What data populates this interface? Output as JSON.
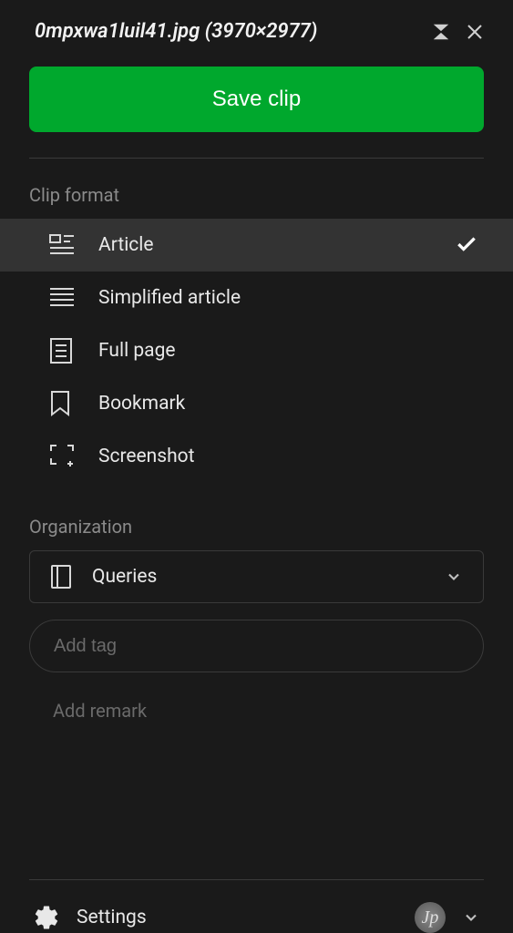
{
  "header": {
    "title": "0mpxwa1luil41.jpg (3970×2977)"
  },
  "actions": {
    "save_label": "Save clip"
  },
  "clip_format": {
    "label": "Clip format",
    "items": [
      {
        "id": "article",
        "label": "Article",
        "selected": true
      },
      {
        "id": "simplified",
        "label": "Simplified article",
        "selected": false
      },
      {
        "id": "fullpage",
        "label": "Full page",
        "selected": false
      },
      {
        "id": "bookmark",
        "label": "Bookmark",
        "selected": false
      },
      {
        "id": "screenshot",
        "label": "Screenshot",
        "selected": false
      }
    ]
  },
  "organization": {
    "label": "Organization",
    "notebook": "Queries",
    "tag_placeholder": "Add tag",
    "remark": "Add remark"
  },
  "footer": {
    "settings_label": "Settings",
    "avatar_initial": "Jp"
  }
}
